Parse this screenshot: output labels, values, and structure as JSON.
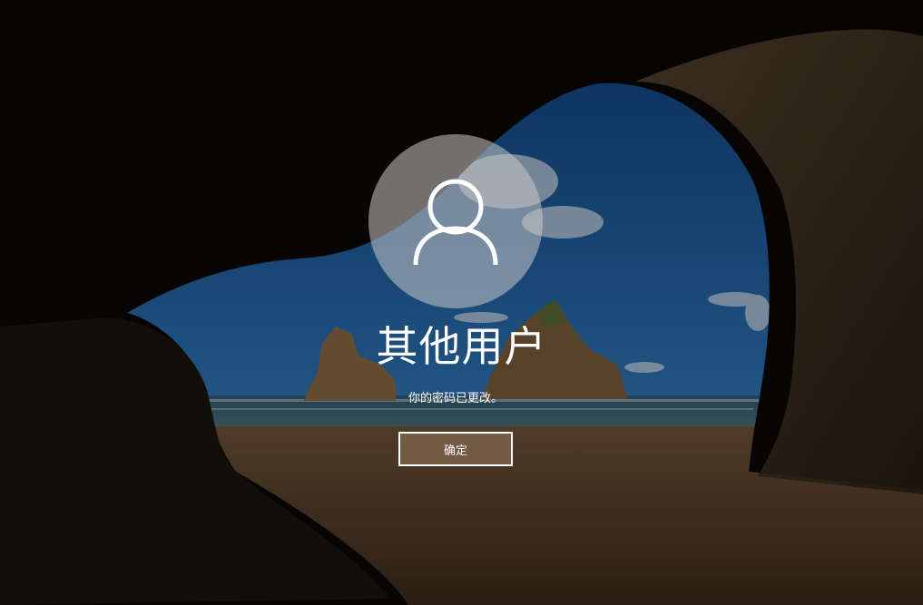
{
  "lock_screen": {
    "avatar_icon": "user-silhouette-icon",
    "username": "其他用户",
    "message": "你的密码已更改。",
    "ok_button_label": "确定",
    "accent_colors": {
      "text": "#ffffff",
      "avatar_bg": "#c8c8c8",
      "button_border": "#ffffff"
    }
  }
}
